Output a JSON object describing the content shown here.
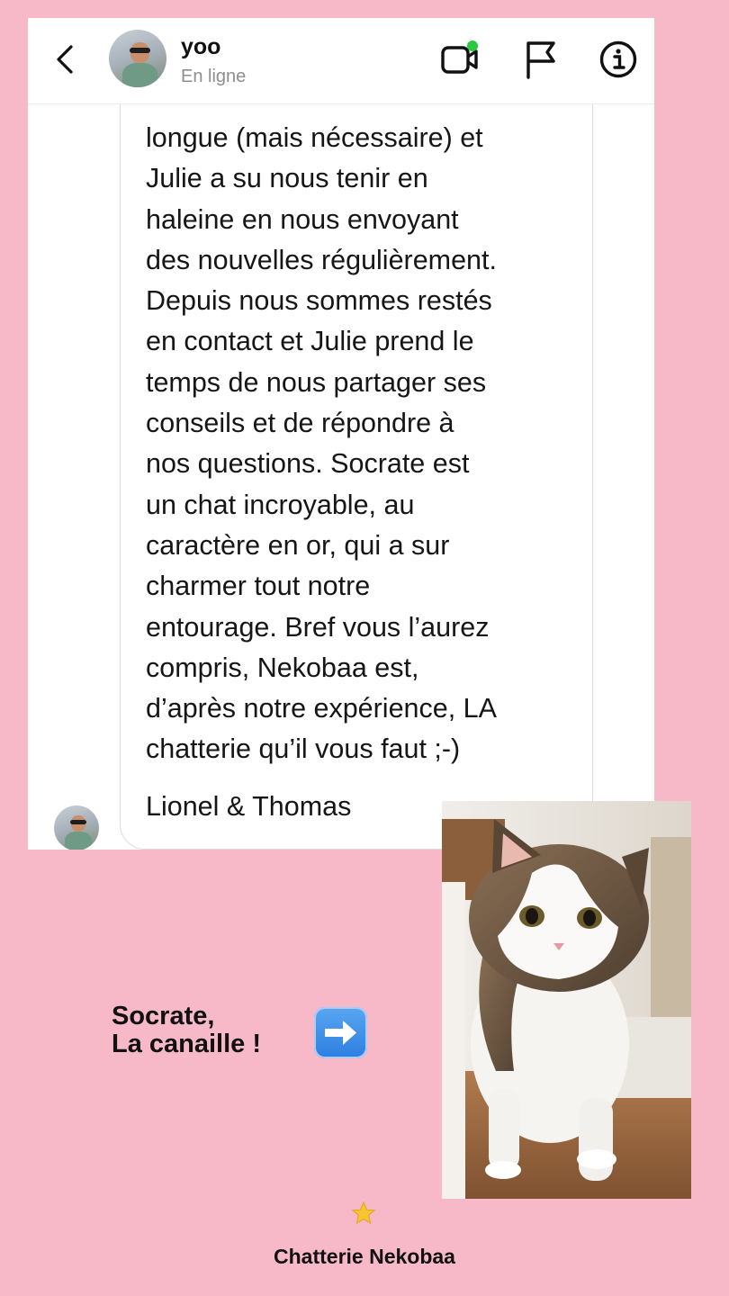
{
  "header": {
    "back_icon": "chevron-left-icon",
    "username": "yoo",
    "status": "En ligne",
    "icons": [
      "video-call-icon",
      "flag-icon",
      "info-icon"
    ],
    "online_dot_color": "#28c840"
  },
  "message": {
    "lines": [
      "longue (mais nécessaire) et",
      "Julie a su nous tenir en",
      "haleine en nous envoyant",
      "des nouvelles régulièrement.",
      "Depuis nous sommes restés",
      "en contact et Julie prend le",
      "temps de nous partager ses",
      "conseils et de répondre à",
      "nos questions. Socrate est",
      "un chat incroyable, au",
      "caractère en or, qui a sur",
      "charmer tout notre",
      "entourage. Bref vous l’aurez",
      "compris, Nekobaa est,",
      "d’après notre expérience, LA",
      "chatterie qu’il vous faut ;-)"
    ],
    "signature": "Lionel & Thomas"
  },
  "story": {
    "caption_line1": "Socrate,",
    "caption_line2": "La canaille !",
    "arrow_icon": "right-arrow-icon",
    "star_icon": "star-icon",
    "brand": "Chatterie Nekobaa",
    "background_color": "#f7b9c8"
  }
}
